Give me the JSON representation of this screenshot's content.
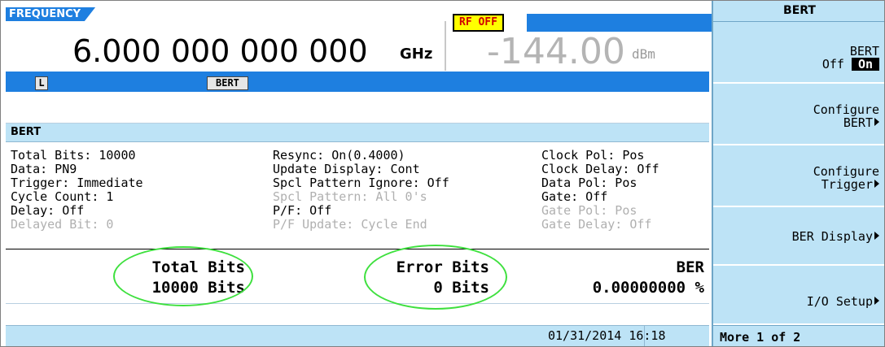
{
  "header": {
    "frequency_label": "FREQUENCY",
    "frequency_value": "6.000 000 000 000",
    "frequency_unit": "GHz",
    "rf_status": "RF OFF",
    "amplitude_value": "-144.00",
    "amplitude_unit": "dBm",
    "indicator_l": "L",
    "indicator_bert": "BERT"
  },
  "panel": {
    "title": "BERT"
  },
  "params": {
    "col1": [
      {
        "text": "Total Bits: 10000",
        "dim": false
      },
      {
        "text": "Data: PN9",
        "dim": false
      },
      {
        "text": "Trigger: Immediate",
        "dim": false
      },
      {
        "text": "Cycle Count: 1",
        "dim": false
      },
      {
        "text": "Delay: Off",
        "dim": false
      },
      {
        "text": "Delayed Bit: 0",
        "dim": true
      }
    ],
    "col2": [
      {
        "text": "Resync: On(0.4000)",
        "dim": false
      },
      {
        "text": "Update Display: Cont",
        "dim": false
      },
      {
        "text": "Spcl Pattern Ignore: Off",
        "dim": false
      },
      {
        "text": "Spcl Pattern: All 0's",
        "dim": true
      },
      {
        "text": "P/F: Off",
        "dim": false
      },
      {
        "text": "P/F Update: Cycle End",
        "dim": true
      }
    ],
    "col3": [
      {
        "text": "Clock Pol: Pos",
        "dim": false
      },
      {
        "text": "Clock Delay: Off",
        "dim": false
      },
      {
        "text": "Data Pol: Pos",
        "dim": false
      },
      {
        "text": "Gate: Off",
        "dim": false
      },
      {
        "text": "Gate Pol: Pos",
        "dim": true
      },
      {
        "text": "Gate Delay: Off",
        "dim": true
      }
    ]
  },
  "results": {
    "total_label": "Total Bits",
    "total_value": "10000 Bits",
    "error_label": "Error Bits",
    "error_value": "0 Bits",
    "ber_label": "BER",
    "ber_value": "0.00000000 %"
  },
  "status": {
    "datetime": "01/31/2014 16:18"
  },
  "softkeys": {
    "title": "BERT",
    "bert_toggle": {
      "line1": "BERT",
      "off": "Off",
      "on": "On"
    },
    "configure_bert": {
      "line1": "Configure",
      "line2": "BERT"
    },
    "configure_trigger": {
      "line1": "Configure",
      "line2": "Trigger"
    },
    "ber_display": "BER Display",
    "io_setup": "I/O Setup",
    "more": "More 1 of 2"
  },
  "colors": {
    "header_blue": "#1e7fe0",
    "panel_light_blue": "#bde3f6",
    "rf_off_bg": "#ffff00",
    "rf_off_text": "#d00000",
    "annotation_circle": "#3ee03e"
  }
}
